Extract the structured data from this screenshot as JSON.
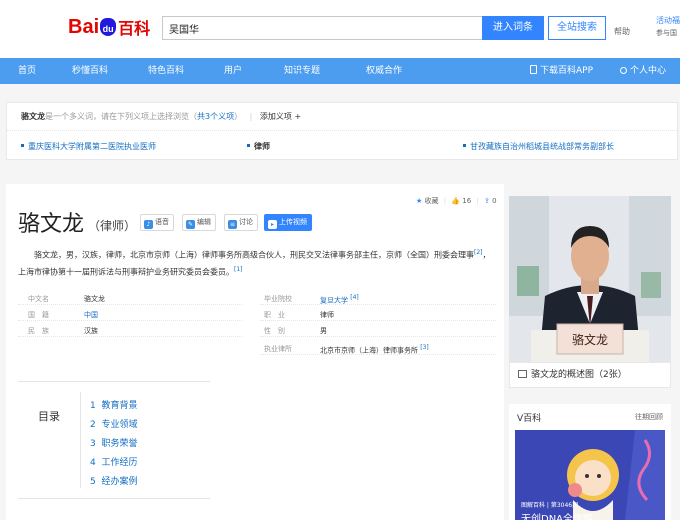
{
  "header": {
    "logo": {
      "bai": "Bai",
      "du": "du",
      "baike": "百科"
    },
    "search_value": "吴国华",
    "enter_button": "进入词条",
    "site_search_button": "全站搜索",
    "help": "帮助",
    "activity": "活动福",
    "activity_sub": "参与国"
  },
  "nav": {
    "items": [
      "首页",
      "秒懂百科",
      "特色百科",
      "用户",
      "知识专题",
      "权威合作"
    ],
    "download": "下载百科APP",
    "personal": "个人中心"
  },
  "disambiguation": {
    "name": "骆文龙",
    "text_a": "是一个多义词，请在下列义项上选择浏览（",
    "count": "共3个义项",
    "text_b": "）",
    "add": "添加义项",
    "add_plus": "+",
    "items": [
      "重庆医科大学附属第二医院执业医师",
      "律师",
      "甘孜藏族自治州稻城县统战部常务副部长"
    ]
  },
  "entry": {
    "title": "骆文龙",
    "subtitle": "（律师）",
    "buttons": [
      "语音",
      "编辑",
      "讨论",
      "上传视频"
    ],
    "collect": "收藏",
    "likes": "16",
    "shares": "0",
    "desc_part1": "骆文龙，男，汉族，律师，北京市京师（上海）律师事务所高级合伙人，刑民交叉法律事务部主任，京师（全国）刑委会理事",
    "ref1": "[2]",
    "desc_part2": "，上海市律协第十一届刑诉法与刑事辩护业务研究委员会委员。",
    "ref2": "[1]",
    "info": [
      {
        "k": "中文名",
        "v": "骆文龙"
      },
      {
        "k": "国　籍",
        "v": "中国",
        "link": true
      },
      {
        "k": "民　族",
        "v": "汉族"
      },
      {
        "k": "毕业院校",
        "v": "复旦大学",
        "link": true,
        "ref": "[4]"
      },
      {
        "k": "职　业",
        "v": "律师"
      },
      {
        "k": "性　别",
        "v": "男"
      },
      {
        "k": "执业律所",
        "v": "北京市京师（上海）律师事务所",
        "ref": "[3]"
      }
    ]
  },
  "toc": {
    "label": "目录",
    "items": [
      {
        "num": "1",
        "label": "教育背景"
      },
      {
        "num": "2",
        "label": "专业领域"
      },
      {
        "num": "3",
        "label": "职务荣誉"
      },
      {
        "num": "4",
        "label": "工作经历"
      },
      {
        "num": "5",
        "label": "经办案例"
      }
    ]
  },
  "side": {
    "nameplate": "骆文龙",
    "album_caption": "骆文龙的概述图（2张）",
    "vbaike_title": "V百科",
    "vbaike_more": "往期回顾",
    "video_tag": "图解百科 | 第3046期",
    "video_title": "无创DNA全攻略"
  }
}
